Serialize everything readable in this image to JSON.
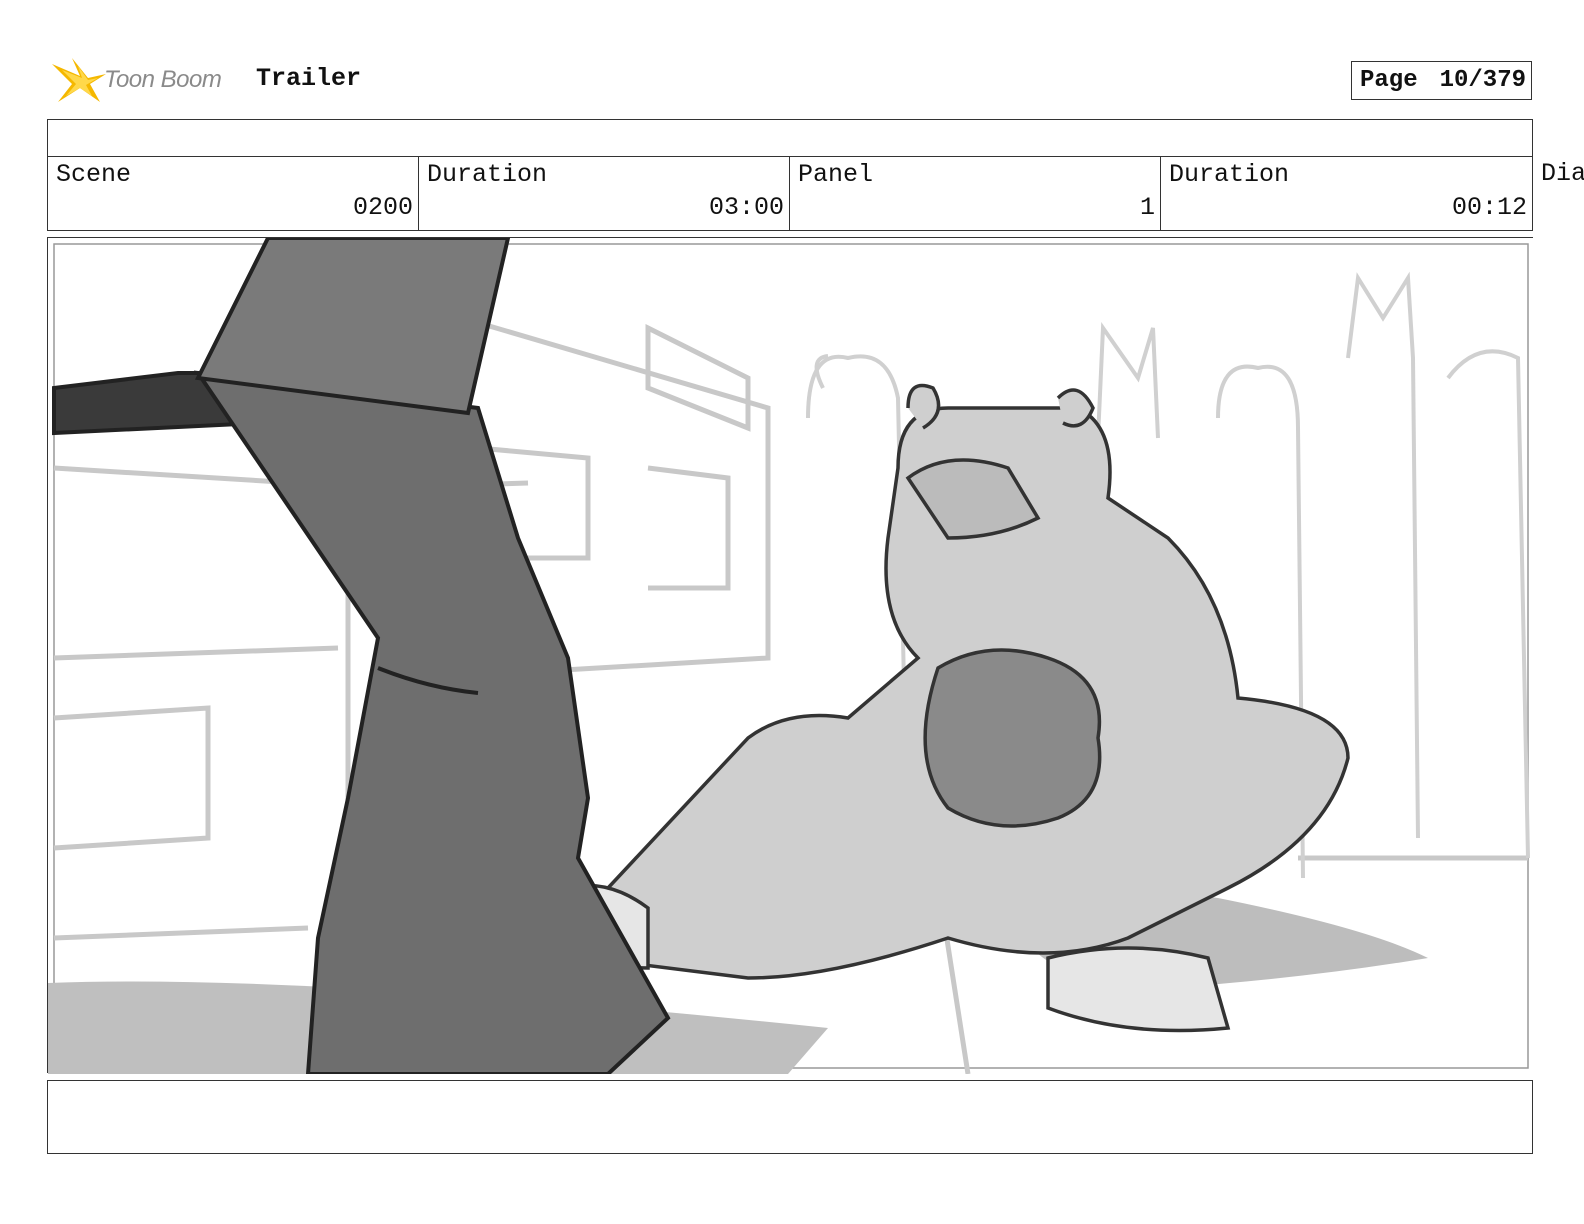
{
  "header": {
    "brand": "Toon Boom",
    "project_title": "Trailer",
    "page_label": "Page",
    "page_number": "10/379"
  },
  "info": {
    "scene_label": "Scene",
    "scene_value": "0200",
    "scene_duration_label": "Duration",
    "scene_duration_value": "03:00",
    "panel_label": "Panel",
    "panel_value": "1",
    "panel_duration_label": "Duration",
    "panel_duration_value": "00:12",
    "dialog_label_clipped": "Dia"
  },
  "caption": {
    "text": ""
  },
  "colors": {
    "brand_yellow": "#f5b800",
    "sketch_dark": "#6e6e6e",
    "sketch_mid": "#bdbdbd",
    "sketch_light": "#dcdcdc"
  }
}
